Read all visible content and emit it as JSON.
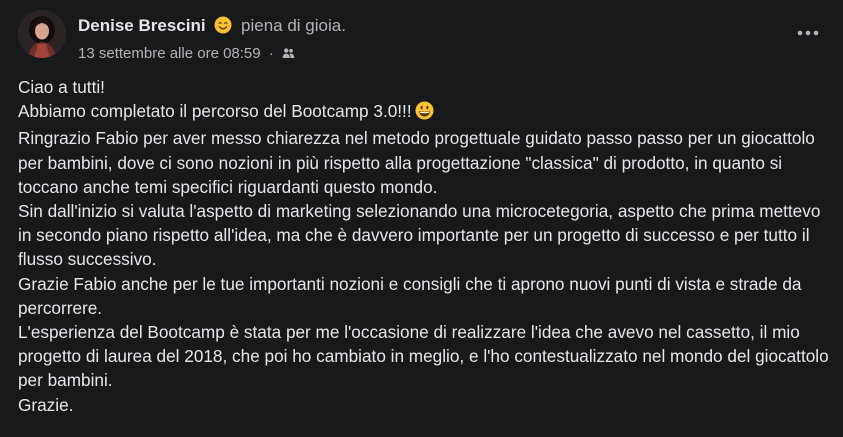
{
  "post": {
    "author": "Denise Brescini",
    "feeling_emoji": "smiling-face-with-smiling-eyes",
    "feeling_text": "piena di gioia.",
    "timestamp": "13 settembre alle ore 08:59",
    "separator": "·",
    "audience_icon": "friends-audience-icon",
    "more_icon": "more-options-icon",
    "paragraphs": [
      "Ciao a tutti!",
      "Abbiamo completato il percorso del Bootcamp 3.0!!!",
      "Ringrazio Fabio per aver messo chiarezza nel metodo progettuale guidato passo passo per un giocattolo per bambini, dove ci sono nozioni in più rispetto alla progettazione \"classica\" di prodotto, in quanto si toccano anche temi specifici riguardanti questo mondo.",
      "Sin dall'inizio si valuta l'aspetto di marketing selezionando una microcetegoria, aspetto che prima mettevo in secondo piano rispetto all'idea, ma che è davvero importante per un progetto di successo e per tutto il flusso successivo.",
      "Grazie Fabio anche per le tue importanti nozioni e consigli che ti aprono nuovi punti di vista e strade da percorrere.",
      "L'esperienza del Bootcamp è stata per me l'occasione di realizzare l'idea che avevo nel cassetto, il mio progetto di laurea del 2018, che poi ho cambiato in meglio, e l'ho contestualizzato nel mondo del giocattolo per bambini.",
      "Grazie."
    ],
    "inline_emoji": "grinning-face"
  },
  "colors": {
    "background": "#18191a",
    "primary_text": "#e4e6eb",
    "secondary_text": "#b0b3b8",
    "emoji_yellow": "#f7c234"
  }
}
